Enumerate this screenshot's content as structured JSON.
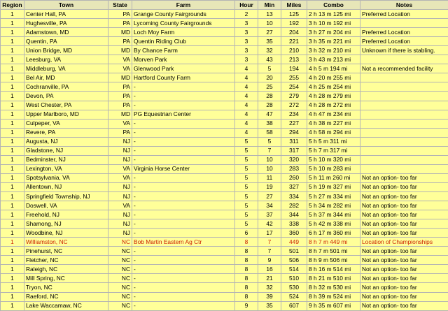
{
  "columns": [
    "Region",
    "Town",
    "State",
    "Farm",
    "Hour",
    "Min",
    "Miles",
    "Combo",
    "Notes"
  ],
  "highlight_color": "#cc2200",
  "background_color": "#ffff99",
  "rows": [
    [
      "1",
      "Center Hall, PA",
      "PA",
      "Grange County Fairgrounds",
      "2",
      "13",
      "125",
      "2 h 13 m 125 mi",
      "Preferred Location"
    ],
    [
      "1",
      "Hughesville, PA",
      "PA",
      "Lycoming County Fairgrounds",
      "3",
      "10",
      "192",
      "3 h 10 m 192 mi",
      ""
    ],
    [
      "1",
      "Adamstown, MD",
      "MD",
      "Loch Moy Farm",
      "3",
      "27",
      "204",
      "3 h 27 m 204 mi",
      "Preferred Location"
    ],
    [
      "1",
      "Quentin, PA",
      "PA",
      "Quentin Riding Club",
      "3",
      "35",
      "221",
      "3 h 35 m 221 mi",
      "Preferred Location"
    ],
    [
      "1",
      "Union Bridge, MD",
      "MD",
      "By Chance Farm",
      "3",
      "32",
      "210",
      "3 h 32 m 210 mi",
      "Unknown if there is stabling."
    ],
    [
      "1",
      "Leesburg, VA",
      "VA",
      "Morven Park",
      "3",
      "43",
      "213",
      "3 h 43 m 213 mi",
      ""
    ],
    [
      "1",
      "Middleburg, VA",
      "VA",
      "Glenwood Park",
      "4",
      "5",
      "194",
      "4 h 5 m 194 mi",
      "Not a recommended facility"
    ],
    [
      "1",
      "Bel Air, MD",
      "MD",
      "Hartford County Farm",
      "4",
      "20",
      "255",
      "4 h 20 m 255 mi",
      ""
    ],
    [
      "1",
      "Cochranville, PA",
      "PA",
      "-",
      "4",
      "25",
      "254",
      "4 h 25 m 254 mi",
      ""
    ],
    [
      "1",
      "Devon, PA",
      "PA",
      "-",
      "4",
      "28",
      "279",
      "4 h 28 m 279 mi",
      ""
    ],
    [
      "1",
      "West Chester, PA",
      "PA",
      "-",
      "4",
      "28",
      "272",
      "4 h 28 m 272 mi",
      ""
    ],
    [
      "1",
      "Upper Marlboro, MD",
      "MD",
      "PG Equestrian Center",
      "4",
      "47",
      "234",
      "4 h 47 m 234 mi",
      ""
    ],
    [
      "1",
      "Culpeper, VA",
      "VA",
      "-",
      "4",
      "38",
      "227",
      "4 h 38 m 227 mi",
      ""
    ],
    [
      "1",
      "Revere, PA",
      "PA",
      "-",
      "4",
      "58",
      "294",
      "4 h 58 m 294 mi",
      ""
    ],
    [
      "1",
      "Augusta, NJ",
      "NJ",
      "-",
      "5",
      "5",
      "311",
      "5 h 5 m 311 mi",
      ""
    ],
    [
      "1",
      "Gladstone, NJ",
      "NJ",
      "-",
      "5",
      "7",
      "317",
      "5 h 7 m 317 mi",
      ""
    ],
    [
      "1",
      "Bedminster, NJ",
      "NJ",
      "-",
      "5",
      "10",
      "320",
      "5 h 10 m 320 mi",
      ""
    ],
    [
      "1",
      "Lexington, VA",
      "VA",
      "Virginia Horse Center",
      "5",
      "10",
      "283",
      "5 h 10 m 283 mi",
      ""
    ],
    [
      "1",
      "Spotsylvania, VA",
      "VA",
      "-",
      "5",
      "11",
      "260",
      "5 h 11 m 260 mi",
      "Not an option- too far"
    ],
    [
      "1",
      "Allentown, NJ",
      "NJ",
      "-",
      "5",
      "19",
      "327",
      "5 h 19 m 327 mi",
      "Not an option- too far"
    ],
    [
      "1",
      "Springfield Township, NJ",
      "NJ",
      "-",
      "5",
      "27",
      "334",
      "5 h 27 m 334 mi",
      "Not an option- too far"
    ],
    [
      "1",
      "Doswell, VA",
      "VA",
      "-",
      "5",
      "34",
      "282",
      "5 h 34 m 282 mi",
      "Not an option- too far"
    ],
    [
      "1",
      "Freehold, NJ",
      "NJ",
      "-",
      "5",
      "37",
      "344",
      "5 h 37 m 344 mi",
      "Not an option- too far"
    ],
    [
      "1",
      "Shamong, NJ",
      "NJ",
      "-",
      "5",
      "42",
      "338",
      "5 h 42 m 338 mi",
      "Not an option- too far"
    ],
    [
      "1",
      "Woodbine, NJ",
      "NJ",
      "-",
      "6",
      "17",
      "360",
      "6 h 17 m 360 mi",
      "Not an option- too far"
    ],
    [
      "1",
      "Williamston, NC",
      "NC",
      "Bob Martin Eastern Ag Ctr",
      "8",
      "7",
      "449",
      "8 h 7 m 449 mi",
      "Location of Championships"
    ],
    [
      "1",
      "Pinehurst, NC",
      "NC",
      "-",
      "8",
      "7",
      "501",
      "8 h 7 m 501 mi",
      "Not an option- too far"
    ],
    [
      "1",
      "Fletcher, NC",
      "NC",
      "-",
      "8",
      "9",
      "506",
      "8 h 9 m 506 mi",
      "Not an option- too far"
    ],
    [
      "1",
      "Raleigh, NC",
      "NC",
      "-",
      "8",
      "16",
      "514",
      "8 h 16 m 514 mi",
      "Not an option- too far"
    ],
    [
      "1",
      "Mill Spring, NC",
      "NC",
      "-",
      "8",
      "21",
      "510",
      "8 h 21 m 510 mi",
      "Not an option- too far"
    ],
    [
      "1",
      "Tryon, NC",
      "NC",
      "-",
      "8",
      "32",
      "530",
      "8 h 32 m 530 mi",
      "Not an option- too far"
    ],
    [
      "1",
      "Raeford, NC",
      "NC",
      "-",
      "8",
      "39",
      "524",
      "8 h 39 m 524 mi",
      "Not an option- too far"
    ],
    [
      "1",
      "Lake Waccamaw, NC",
      "NC",
      "-",
      "9",
      "35",
      "607",
      "9 h 35 m 607 mi",
      "Not an option- too far"
    ]
  ],
  "highlight_row_index": 25
}
